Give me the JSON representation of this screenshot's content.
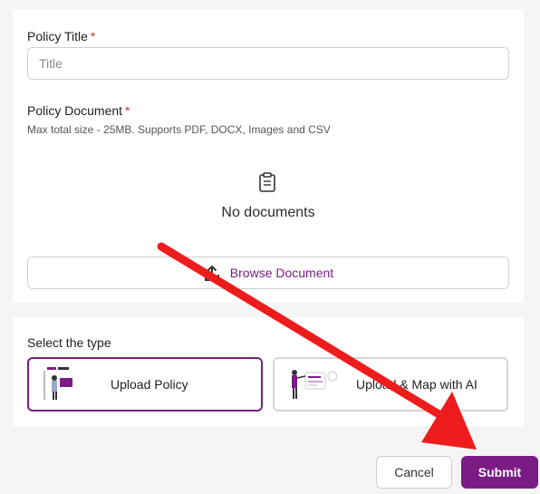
{
  "policy_title": {
    "label": "Policy Title",
    "required_mark": "*",
    "placeholder": "Title",
    "value": ""
  },
  "policy_document": {
    "label": "Policy Document",
    "required_mark": "*",
    "hint": "Max total size - 25MB. Supports PDF, DOCX, Images and CSV",
    "empty_text": "No documents",
    "browse_label": "Browse Document"
  },
  "type_select": {
    "label": "Select the type",
    "options": [
      {
        "label": "Upload Policy",
        "selected": true
      },
      {
        "label": "Upload & Map with AI",
        "selected": false
      }
    ]
  },
  "footer": {
    "cancel_label": "Cancel",
    "submit_label": "Submit"
  },
  "colors": {
    "accent": "#7b1b86",
    "required": "#d32f2f",
    "annotation_arrow": "#ee1c1c"
  },
  "icons": [
    "clipboard-icon",
    "upload-icon",
    "upload-policy-illustration",
    "ai-map-illustration",
    "annotation-arrow"
  ]
}
